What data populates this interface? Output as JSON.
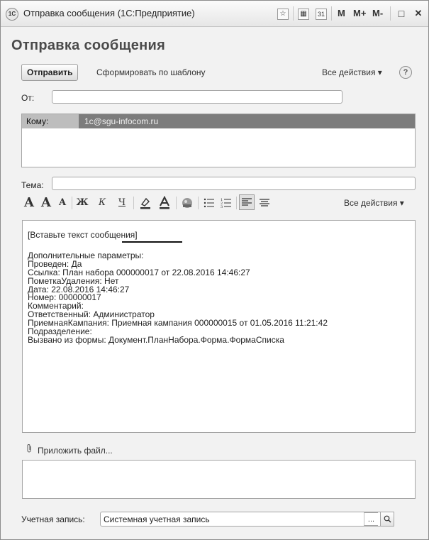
{
  "window": {
    "title": "Отправка сообщения  (1С:Предприятие)",
    "app_icon": "1С",
    "buttons": {
      "favorite": "☆",
      "calculator": "▦",
      "calendar": "31",
      "m": "M",
      "m_plus": "M+",
      "m_minus": "M-",
      "maximize": "□",
      "close": "✕"
    }
  },
  "form": {
    "title": "Отправка сообщения",
    "send_button": "Отправить",
    "template_button": "Сформировать по шаблону",
    "all_actions": "Все действия ▾",
    "help": "?"
  },
  "from": {
    "label": "От:",
    "value": ""
  },
  "to": {
    "label": "Кому:",
    "value": "1c@sgu-infocom.ru"
  },
  "subject": {
    "label": "Тема:",
    "value": ""
  },
  "format_toolbar": {
    "font_big": "A",
    "font_up": "A",
    "font_down": "A",
    "bold": "Ж",
    "italic": "К",
    "underline": "Ч",
    "all_actions": "Все действия ▾"
  },
  "editor": {
    "placeholder": "[Вставьте текст сообщения]",
    "lines": [
      "Дополнительные параметры:",
      "Проведен: Да",
      "Ссылка: План набора 000000017 от 22.08.2016 14:46:27",
      "ПометкаУдаления: Нет",
      "Дата: 22.08.2016 14:46:27",
      "Номер: 000000017",
      "Комментарий:",
      "Ответственный: Администратор",
      "ПриемнаяКампания: Приемная кампания 000000015 от 01.05.2016 11:21:42",
      "Подразделение:",
      "Вызвано из формы: Документ.ПланНабора.Форма.ФормаСписка"
    ]
  },
  "attach": {
    "label": "Приложить файл..."
  },
  "account": {
    "label": "Учетная запись:",
    "value": "Системная учетная запись"
  }
}
